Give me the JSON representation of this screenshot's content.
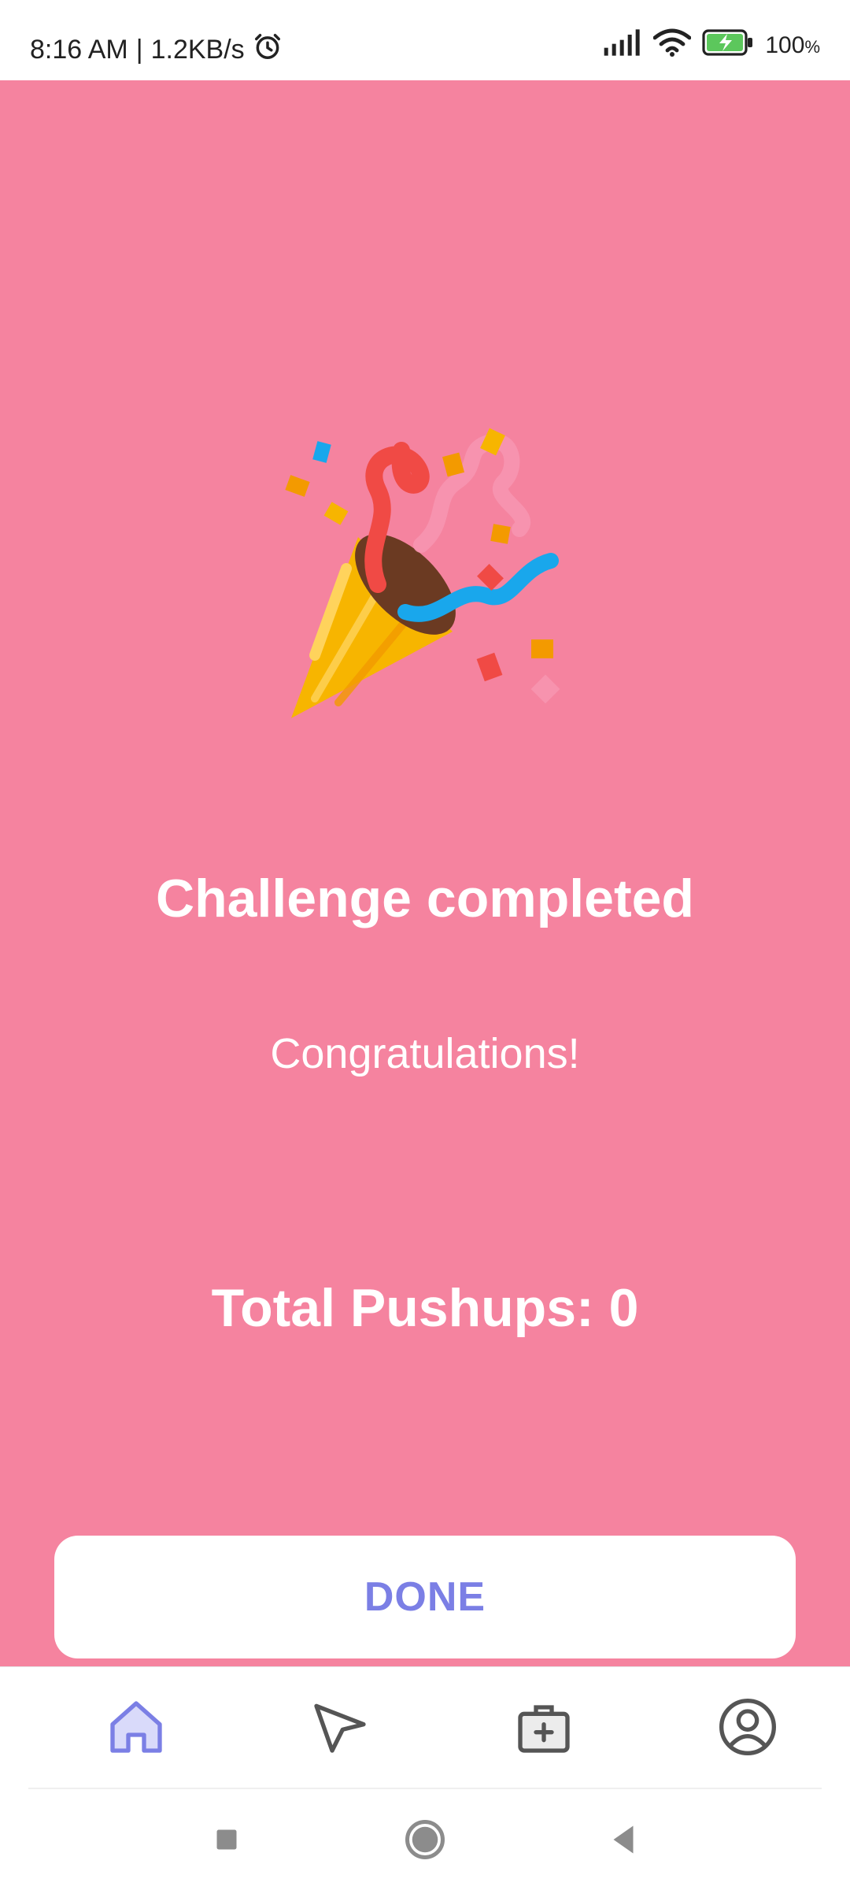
{
  "status_bar": {
    "time": "8:16 AM",
    "speed": "1.2KB/s",
    "battery": "100",
    "battery_unit": "%"
  },
  "main": {
    "title": "Challenge completed",
    "subtitle": "Congratulations!",
    "total_label": "Total Pushups: 0",
    "done_label": "DONE"
  },
  "bottom_nav": {
    "items": [
      {
        "icon": "home-icon",
        "active": true
      },
      {
        "icon": "navigation-arrow-icon",
        "active": false
      },
      {
        "icon": "medical-kit-icon",
        "active": false
      },
      {
        "icon": "profile-icon",
        "active": false
      }
    ],
    "active_color": "#7b7fe5",
    "inactive_color": "#555555"
  },
  "colors": {
    "background": "#f5839f",
    "accent": "#7b7fe5"
  }
}
